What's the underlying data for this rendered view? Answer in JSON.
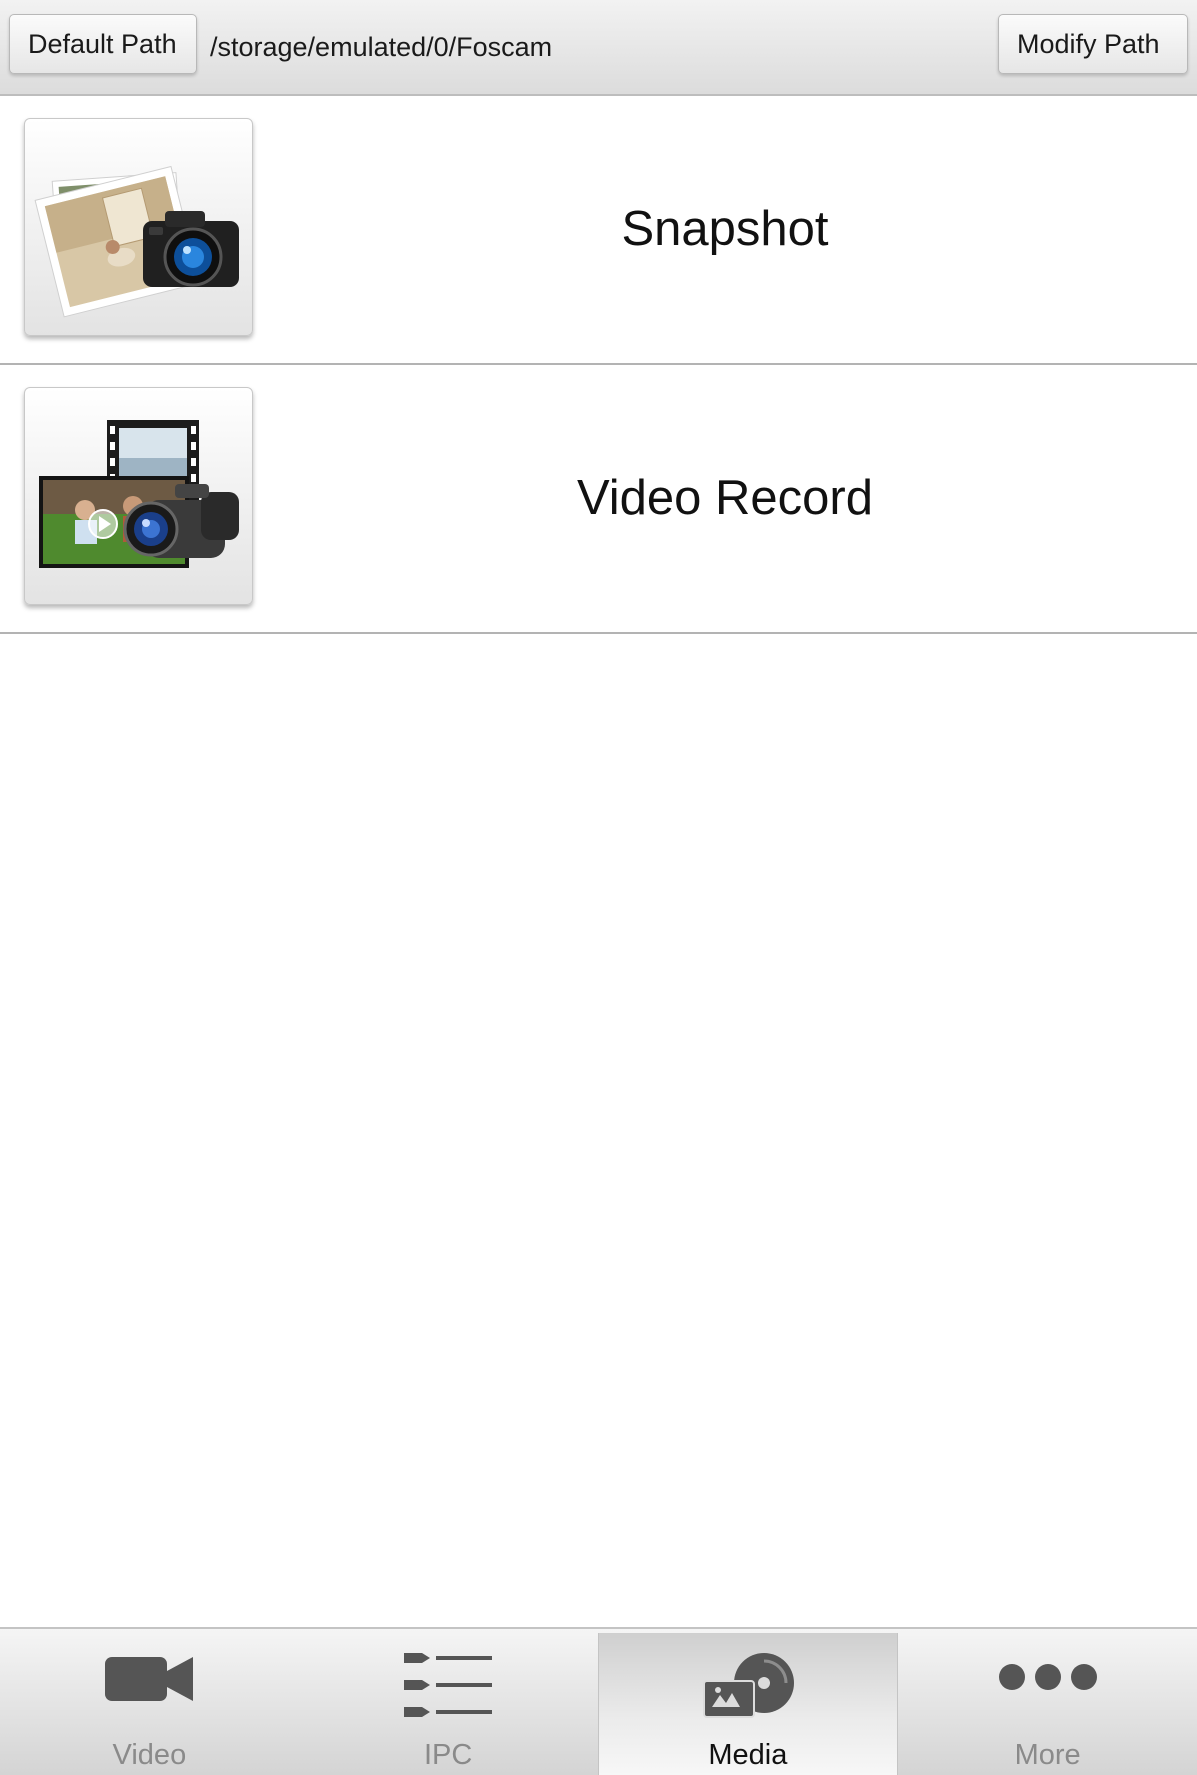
{
  "path_bar": {
    "default_button_label": "Default Path",
    "current_path": "/storage/emulated/0/Foscam",
    "modify_button_label": "Modify Path"
  },
  "media_items": [
    {
      "label": "Snapshot",
      "icon": "camera-photo-icon"
    },
    {
      "label": "Video Record",
      "icon": "camcorder-film-icon"
    }
  ],
  "tabs": [
    {
      "label": "Video",
      "icon": "video-camera-icon",
      "active": false
    },
    {
      "label": "IPC",
      "icon": "list-icon",
      "active": false
    },
    {
      "label": "Media",
      "icon": "media-icon",
      "active": true
    },
    {
      "label": "More",
      "icon": "more-dots-icon",
      "active": false
    }
  ],
  "colors": {
    "active_tab_label": "#111111",
    "inactive_tab_label": "#8a8a8a",
    "tab_icon": "#555555"
  }
}
